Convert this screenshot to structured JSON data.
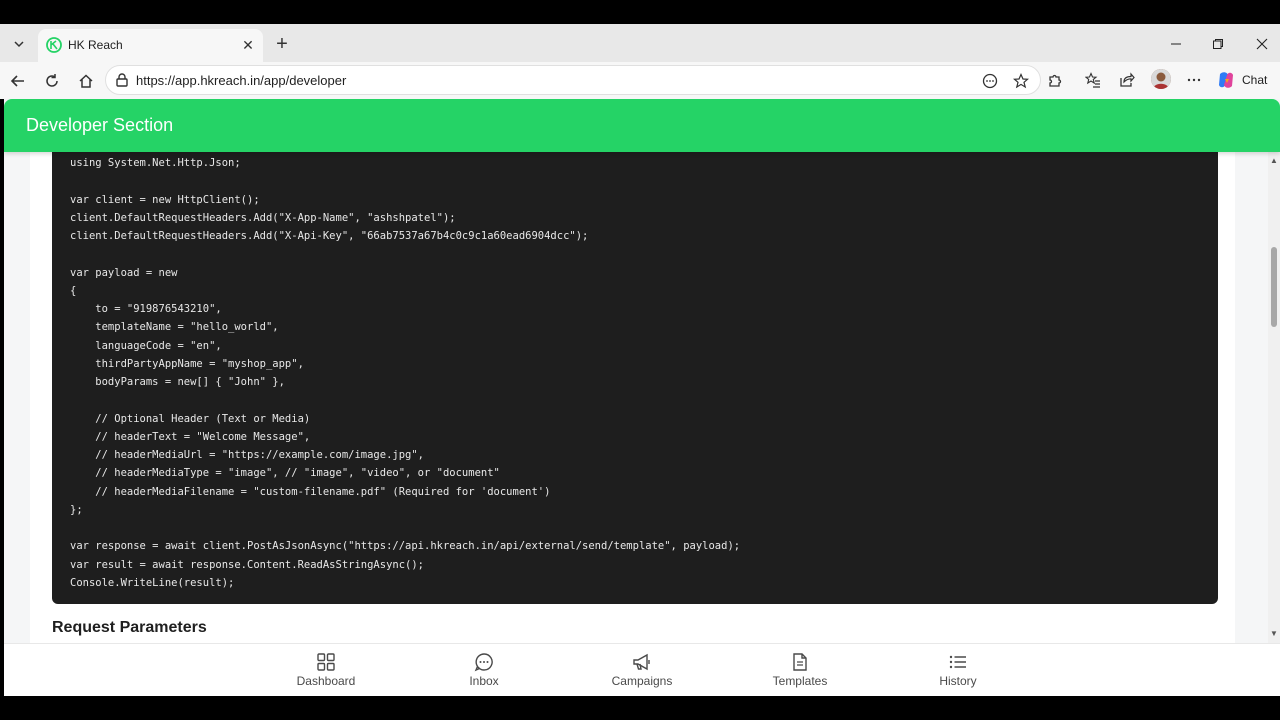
{
  "browser": {
    "tab_title": "HK Reach",
    "url": "https://app.hkreach.in/app/developer",
    "chat_label": "Chat"
  },
  "page": {
    "header_title": "Developer Section",
    "code_lines": [
      "using System.Net.Http.Json;",
      "",
      "var client = new HttpClient();",
      "client.DefaultRequestHeaders.Add(\"X-App-Name\", \"ashshpatel\");",
      "client.DefaultRequestHeaders.Add(\"X-Api-Key\", \"66ab7537a67b4c0c9c1a60ead6904dcc\");",
      "",
      "var payload = new",
      "{",
      "    to = \"919876543210\",",
      "    templateName = \"hello_world\",",
      "    languageCode = \"en\",",
      "    thirdPartyAppName = \"myshop_app\",",
      "    bodyParams = new[] { \"John\" },",
      "",
      "    // Optional Header (Text or Media)",
      "    // headerText = \"Welcome Message\",",
      "    // headerMediaUrl = \"https://example.com/image.jpg\",",
      "    // headerMediaType = \"image\", // \"image\", \"video\", or \"document\"",
      "    // headerMediaFilename = \"custom-filename.pdf\" (Required for 'document')",
      "};",
      "",
      "var response = await client.PostAsJsonAsync(\"https://api.hkreach.in/api/external/send/template\", payload);",
      "var result = await response.Content.ReadAsStringAsync();",
      "Console.WriteLine(result);"
    ],
    "section_heading": "Request Parameters"
  },
  "bottom_nav": {
    "items": [
      {
        "label": "Dashboard",
        "icon": "grid-icon"
      },
      {
        "label": "Inbox",
        "icon": "chat-bubble-icon"
      },
      {
        "label": "Campaigns",
        "icon": "megaphone-icon"
      },
      {
        "label": "Templates",
        "icon": "document-icon"
      },
      {
        "label": "History",
        "icon": "list-icon"
      }
    ]
  },
  "colors": {
    "brand_green": "#25d366",
    "code_bg": "#1e1e1e"
  }
}
